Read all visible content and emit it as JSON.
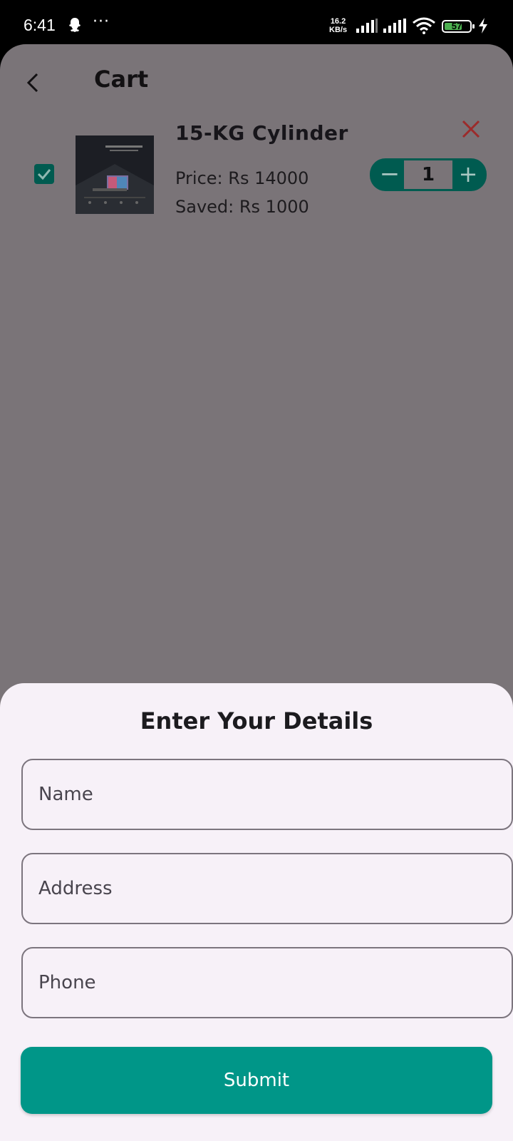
{
  "status_bar": {
    "time": "6:41",
    "more_icon": "···",
    "net_speed_value": "16.2",
    "net_speed_unit": "KB/s",
    "battery": "57"
  },
  "header": {
    "title": "Cart"
  },
  "cart_item": {
    "name": "15-KG Cylinder",
    "price": "Price: Rs 14000",
    "saved": "Saved: Rs 1000",
    "quantity": "1",
    "minus_symbol": "−",
    "plus_symbol": "+",
    "selected": true
  },
  "sheet": {
    "title": "Enter Your Details",
    "name_placeholder": "Name",
    "address_placeholder": "Address",
    "phone_placeholder": "Phone",
    "submit_label": "Submit"
  },
  "colors": {
    "accent": "#009688",
    "dark_accent": "#005b50",
    "remove": "#9c2b2b",
    "overlay": "#7a7478",
    "sheet_bg": "#f7f1f8"
  }
}
